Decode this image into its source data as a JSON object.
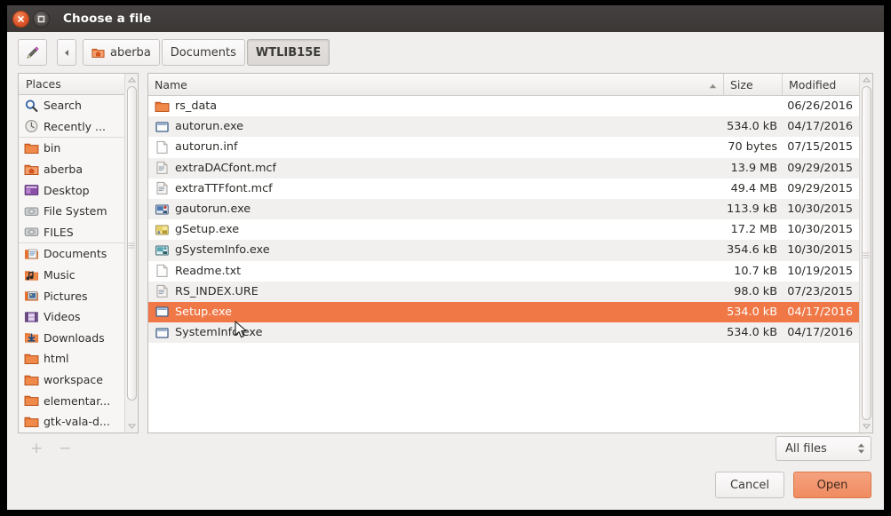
{
  "window": {
    "title": "Choose a file",
    "close_icon": "close-icon",
    "maximize_icon": "maximize-icon"
  },
  "toolbar": {
    "pencil_icon": "pencil-icon",
    "back_icon": "chevron-left-icon",
    "breadcrumbs": [
      {
        "label": "aberba",
        "icon": "home-folder-icon",
        "active": false
      },
      {
        "label": "Documents",
        "icon": "",
        "active": false
      },
      {
        "label": "WTLIB15E",
        "icon": "",
        "active": true
      }
    ]
  },
  "sidebar": {
    "header": "Places",
    "items": [
      {
        "label": "Search",
        "icon": "search-icon",
        "sep": false
      },
      {
        "label": "Recently ...",
        "icon": "recent-icon",
        "sep": false
      },
      {
        "label": "bin",
        "icon": "folder-icon",
        "sep": true
      },
      {
        "label": "aberba",
        "icon": "home-folder-icon",
        "sep": false
      },
      {
        "label": "Desktop",
        "icon": "desktop-icon",
        "sep": false
      },
      {
        "label": "File System",
        "icon": "drive-icon",
        "sep": false
      },
      {
        "label": "FILES",
        "icon": "drive-icon",
        "sep": false
      },
      {
        "label": "Documents",
        "icon": "documents-icon",
        "sep": true
      },
      {
        "label": "Music",
        "icon": "music-icon",
        "sep": false
      },
      {
        "label": "Pictures",
        "icon": "pictures-icon",
        "sep": false
      },
      {
        "label": "Videos",
        "icon": "videos-icon",
        "sep": false
      },
      {
        "label": "Downloads",
        "icon": "downloads-icon",
        "sep": false
      },
      {
        "label": "html",
        "icon": "folder-icon",
        "sep": false
      },
      {
        "label": "workspace",
        "icon": "folder-icon",
        "sep": false
      },
      {
        "label": "elementar...",
        "icon": "folder-icon",
        "sep": false
      },
      {
        "label": "gtk-vala-d...",
        "icon": "folder-icon",
        "sep": false
      }
    ],
    "add_label": "+",
    "remove_label": "−"
  },
  "filelist": {
    "columns": {
      "name": "Name",
      "size": "Size",
      "modified": "Modified"
    },
    "sort_column": "Name",
    "sort_direction": "ascending",
    "rows": [
      {
        "name": "rs_data",
        "size": "",
        "modified": "06/26/2016",
        "icon": "folder-icon",
        "selected": false
      },
      {
        "name": "autorun.exe",
        "size": "534.0 kB",
        "modified": "04/17/2016",
        "icon": "exe-icon",
        "selected": false
      },
      {
        "name": "autorun.inf",
        "size": "70 bytes",
        "modified": "07/15/2015",
        "icon": "blank-file-icon",
        "selected": false
      },
      {
        "name": "extraDACfont.mcf",
        "size": "13.9 MB",
        "modified": "09/29/2015",
        "icon": "text-file-icon",
        "selected": false
      },
      {
        "name": "extraTTFfont.mcf",
        "size": "49.4 MB",
        "modified": "09/29/2015",
        "icon": "text-file-icon",
        "selected": false
      },
      {
        "name": "gautorun.exe",
        "size": "113.9 kB",
        "modified": "10/30/2015",
        "icon": "app-blue-icon",
        "selected": false
      },
      {
        "name": "gSetup.exe",
        "size": "17.2 MB",
        "modified": "10/30/2015",
        "icon": "app-yellow-icon",
        "selected": false
      },
      {
        "name": "gSystemInfo.exe",
        "size": "354.6 kB",
        "modified": "10/30/2015",
        "icon": "app-teal-icon",
        "selected": false
      },
      {
        "name": "Readme.txt",
        "size": "10.7 kB",
        "modified": "10/19/2015",
        "icon": "blank-file-icon",
        "selected": false
      },
      {
        "name": "RS_INDEX.URE",
        "size": "98.0 kB",
        "modified": "07/23/2015",
        "icon": "text-file-icon",
        "selected": false
      },
      {
        "name": "Setup.exe",
        "size": "534.0 kB",
        "modified": "04/17/2016",
        "icon": "exe-icon",
        "selected": true
      },
      {
        "name": "SystemInfo.exe",
        "size": "534.0 kB",
        "modified": "04/17/2016",
        "icon": "exe-icon",
        "selected": false
      }
    ]
  },
  "filter": {
    "selected": "All files",
    "options": [
      "All files"
    ]
  },
  "actions": {
    "cancel": "Cancel",
    "open": "Open"
  },
  "colors": {
    "selection": "#f07746",
    "titlebar": "#3e3b39",
    "window_bg": "#f1efee",
    "open_button": "#f08b60"
  }
}
